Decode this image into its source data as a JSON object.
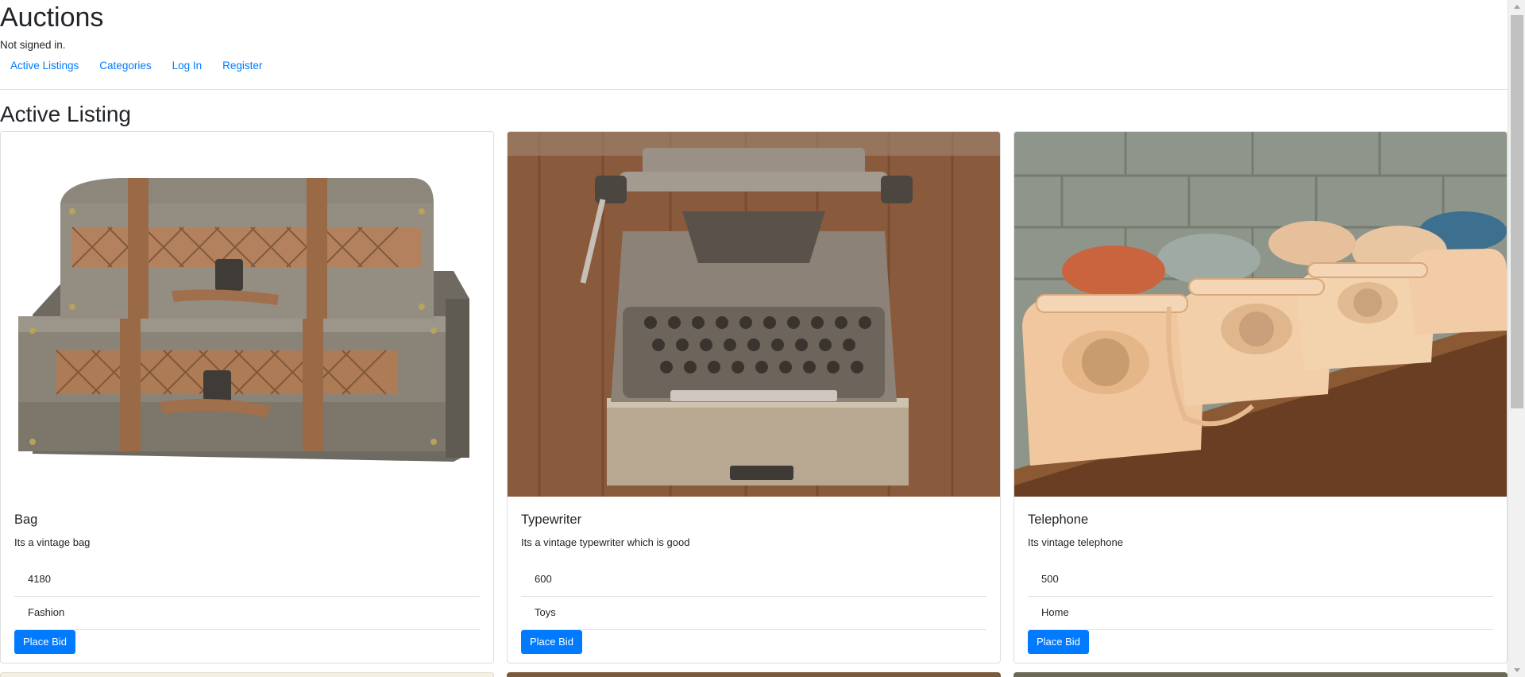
{
  "header": {
    "title": "Auctions",
    "status": "Not signed in."
  },
  "nav": {
    "items": [
      {
        "label": "Active Listings"
      },
      {
        "label": "Categories"
      },
      {
        "label": "Log In"
      },
      {
        "label": "Register"
      }
    ]
  },
  "main": {
    "heading": "Active Listing",
    "listings": [
      {
        "title": "Bag",
        "description": "Its a vintage bag",
        "price": "4180",
        "category": "Fashion",
        "button": "Place Bid",
        "image": "vintage-chest-image"
      },
      {
        "title": "Typewriter",
        "description": "Its a vintage typewriter which is good",
        "price": "600",
        "category": "Toys",
        "button": "Place Bid",
        "image": "typewriter-image"
      },
      {
        "title": "Telephone",
        "description": "Its vintage telephone",
        "price": "500",
        "category": "Home",
        "button": "Place Bid",
        "image": "rotary-telephones-image"
      }
    ]
  },
  "colors": {
    "link": "#007bff",
    "button": "#007bff",
    "text": "#212529"
  }
}
